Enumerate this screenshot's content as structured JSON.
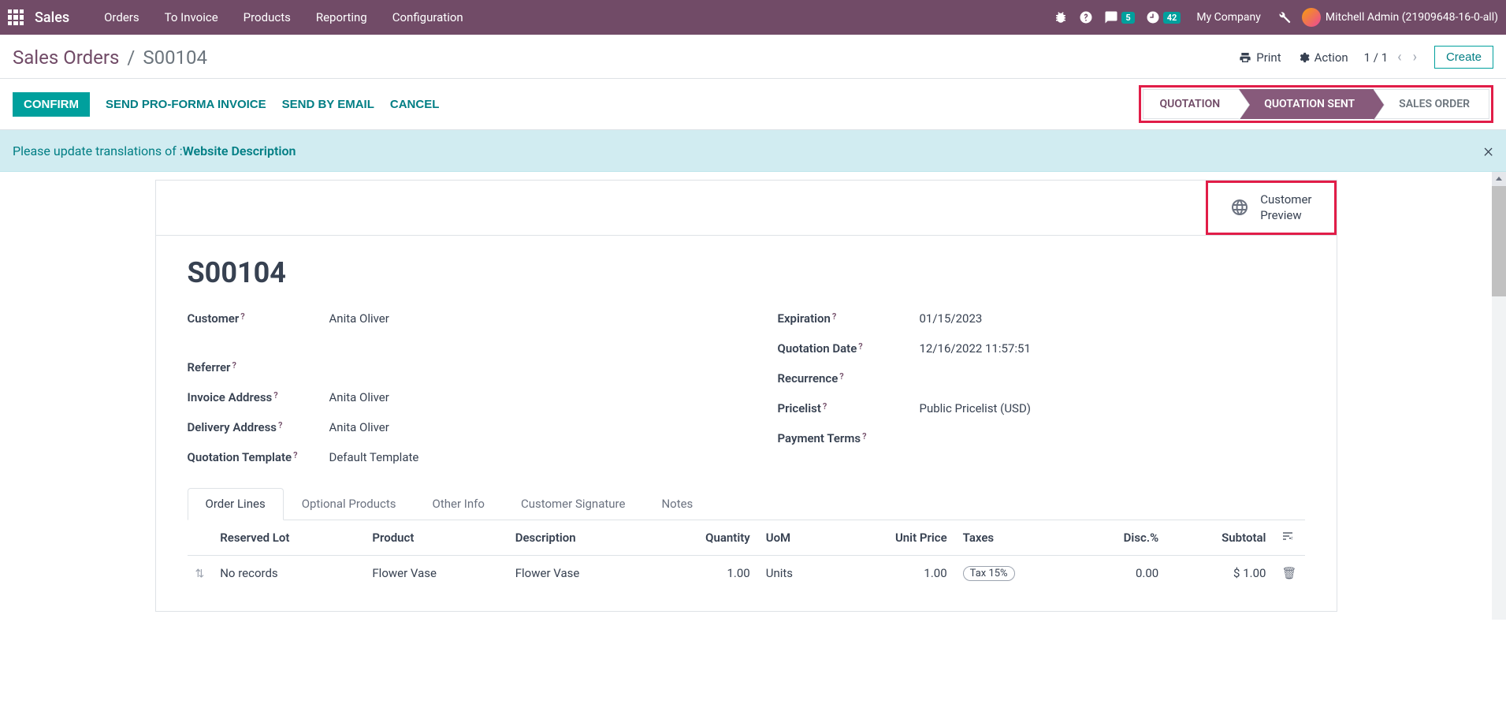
{
  "nav": {
    "brand": "Sales",
    "items": [
      "Orders",
      "To Invoice",
      "Products",
      "Reporting",
      "Configuration"
    ],
    "messages_badge": "5",
    "activities_badge": "42",
    "company": "My Company",
    "user": "Mitchell Admin (21909648-16-0-all)"
  },
  "breadcrumb": {
    "parent": "Sales Orders",
    "sep": "/",
    "current": "S00104"
  },
  "actions": {
    "print": "Print",
    "action": "Action",
    "pager": "1 / 1",
    "create": "Create"
  },
  "status_buttons": {
    "confirm": "CONFIRM",
    "proforma": "SEND PRO-FORMA INVOICE",
    "email": "SEND BY EMAIL",
    "cancel": "CANCEL"
  },
  "stages": {
    "quotation": "QUOTATION",
    "quotation_sent": "QUOTATION SENT",
    "sales_order": "SALES ORDER"
  },
  "alert": {
    "prefix": "Please update translations of : ",
    "link": "Website Description"
  },
  "customer_preview": {
    "line1": "Customer",
    "line2": "Preview"
  },
  "order": {
    "name": "S00104",
    "fields_left": {
      "customer": {
        "label": "Customer",
        "value": "Anita Oliver"
      },
      "referrer": {
        "label": "Referrer",
        "value": ""
      },
      "invoice_address": {
        "label": "Invoice Address",
        "value": "Anita Oliver"
      },
      "delivery_address": {
        "label": "Delivery Address",
        "value": "Anita Oliver"
      },
      "quotation_template": {
        "label": "Quotation Template",
        "value": "Default Template"
      }
    },
    "fields_right": {
      "expiration": {
        "label": "Expiration",
        "value": "01/15/2023"
      },
      "quotation_date": {
        "label": "Quotation Date",
        "value": "12/16/2022 11:57:51"
      },
      "recurrence": {
        "label": "Recurrence",
        "value": ""
      },
      "pricelist": {
        "label": "Pricelist",
        "value": "Public Pricelist (USD)"
      },
      "payment_terms": {
        "label": "Payment Terms",
        "value": ""
      }
    }
  },
  "tabs": {
    "order_lines": "Order Lines",
    "optional_products": "Optional Products",
    "other_info": "Other Info",
    "customer_signature": "Customer Signature",
    "notes": "Notes"
  },
  "table": {
    "headers": {
      "reserved_lot": "Reserved Lot",
      "product": "Product",
      "description": "Description",
      "quantity": "Quantity",
      "uom": "UoM",
      "unit_price": "Unit Price",
      "taxes": "Taxes",
      "disc": "Disc.%",
      "subtotal": "Subtotal"
    },
    "rows": [
      {
        "reserved_lot": "No records",
        "product": "Flower Vase",
        "description": "Flower Vase",
        "quantity": "1.00",
        "uom": "Units",
        "unit_price": "1.00",
        "taxes": "Tax 15%",
        "disc": "0.00",
        "subtotal": "$ 1.00"
      }
    ]
  }
}
